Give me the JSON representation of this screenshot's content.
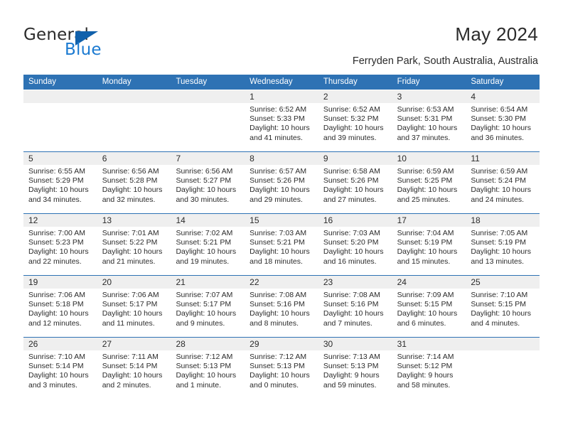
{
  "logo": {
    "word_one": "General",
    "word_two": "Blue",
    "triangle_color": "#1161ab",
    "blue_text_color": "#1b7ad1"
  },
  "header": {
    "title": "May 2024",
    "subtitle": "Ferryden Park, South Australia, Australia",
    "accent_color": "#2e72b4",
    "numrow_background": "#efefef"
  },
  "weekdays": [
    "Sunday",
    "Monday",
    "Tuesday",
    "Wednesday",
    "Thursday",
    "Friday",
    "Saturday"
  ],
  "weeks": [
    {
      "days": [
        {
          "number": "",
          "sunrise": "",
          "sunset": "",
          "daylight": ""
        },
        {
          "number": "",
          "sunrise": "",
          "sunset": "",
          "daylight": ""
        },
        {
          "number": "",
          "sunrise": "",
          "sunset": "",
          "daylight": ""
        },
        {
          "number": "1",
          "sunrise": "Sunrise: 6:52 AM",
          "sunset": "Sunset: 5:33 PM",
          "daylight": "Daylight: 10 hours and 41 minutes."
        },
        {
          "number": "2",
          "sunrise": "Sunrise: 6:52 AM",
          "sunset": "Sunset: 5:32 PM",
          "daylight": "Daylight: 10 hours and 39 minutes."
        },
        {
          "number": "3",
          "sunrise": "Sunrise: 6:53 AM",
          "sunset": "Sunset: 5:31 PM",
          "daylight": "Daylight: 10 hours and 37 minutes."
        },
        {
          "number": "4",
          "sunrise": "Sunrise: 6:54 AM",
          "sunset": "Sunset: 5:30 PM",
          "daylight": "Daylight: 10 hours and 36 minutes."
        }
      ]
    },
    {
      "days": [
        {
          "number": "5",
          "sunrise": "Sunrise: 6:55 AM",
          "sunset": "Sunset: 5:29 PM",
          "daylight": "Daylight: 10 hours and 34 minutes."
        },
        {
          "number": "6",
          "sunrise": "Sunrise: 6:56 AM",
          "sunset": "Sunset: 5:28 PM",
          "daylight": "Daylight: 10 hours and 32 minutes."
        },
        {
          "number": "7",
          "sunrise": "Sunrise: 6:56 AM",
          "sunset": "Sunset: 5:27 PM",
          "daylight": "Daylight: 10 hours and 30 minutes."
        },
        {
          "number": "8",
          "sunrise": "Sunrise: 6:57 AM",
          "sunset": "Sunset: 5:26 PM",
          "daylight": "Daylight: 10 hours and 29 minutes."
        },
        {
          "number": "9",
          "sunrise": "Sunrise: 6:58 AM",
          "sunset": "Sunset: 5:26 PM",
          "daylight": "Daylight: 10 hours and 27 minutes."
        },
        {
          "number": "10",
          "sunrise": "Sunrise: 6:59 AM",
          "sunset": "Sunset: 5:25 PM",
          "daylight": "Daylight: 10 hours and 25 minutes."
        },
        {
          "number": "11",
          "sunrise": "Sunrise: 6:59 AM",
          "sunset": "Sunset: 5:24 PM",
          "daylight": "Daylight: 10 hours and 24 minutes."
        }
      ]
    },
    {
      "days": [
        {
          "number": "12",
          "sunrise": "Sunrise: 7:00 AM",
          "sunset": "Sunset: 5:23 PM",
          "daylight": "Daylight: 10 hours and 22 minutes."
        },
        {
          "number": "13",
          "sunrise": "Sunrise: 7:01 AM",
          "sunset": "Sunset: 5:22 PM",
          "daylight": "Daylight: 10 hours and 21 minutes."
        },
        {
          "number": "14",
          "sunrise": "Sunrise: 7:02 AM",
          "sunset": "Sunset: 5:21 PM",
          "daylight": "Daylight: 10 hours and 19 minutes."
        },
        {
          "number": "15",
          "sunrise": "Sunrise: 7:03 AM",
          "sunset": "Sunset: 5:21 PM",
          "daylight": "Daylight: 10 hours and 18 minutes."
        },
        {
          "number": "16",
          "sunrise": "Sunrise: 7:03 AM",
          "sunset": "Sunset: 5:20 PM",
          "daylight": "Daylight: 10 hours and 16 minutes."
        },
        {
          "number": "17",
          "sunrise": "Sunrise: 7:04 AM",
          "sunset": "Sunset: 5:19 PM",
          "daylight": "Daylight: 10 hours and 15 minutes."
        },
        {
          "number": "18",
          "sunrise": "Sunrise: 7:05 AM",
          "sunset": "Sunset: 5:19 PM",
          "daylight": "Daylight: 10 hours and 13 minutes."
        }
      ]
    },
    {
      "days": [
        {
          "number": "19",
          "sunrise": "Sunrise: 7:06 AM",
          "sunset": "Sunset: 5:18 PM",
          "daylight": "Daylight: 10 hours and 12 minutes."
        },
        {
          "number": "20",
          "sunrise": "Sunrise: 7:06 AM",
          "sunset": "Sunset: 5:17 PM",
          "daylight": "Daylight: 10 hours and 11 minutes."
        },
        {
          "number": "21",
          "sunrise": "Sunrise: 7:07 AM",
          "sunset": "Sunset: 5:17 PM",
          "daylight": "Daylight: 10 hours and 9 minutes."
        },
        {
          "number": "22",
          "sunrise": "Sunrise: 7:08 AM",
          "sunset": "Sunset: 5:16 PM",
          "daylight": "Daylight: 10 hours and 8 minutes."
        },
        {
          "number": "23",
          "sunrise": "Sunrise: 7:08 AM",
          "sunset": "Sunset: 5:16 PM",
          "daylight": "Daylight: 10 hours and 7 minutes."
        },
        {
          "number": "24",
          "sunrise": "Sunrise: 7:09 AM",
          "sunset": "Sunset: 5:15 PM",
          "daylight": "Daylight: 10 hours and 6 minutes."
        },
        {
          "number": "25",
          "sunrise": "Sunrise: 7:10 AM",
          "sunset": "Sunset: 5:15 PM",
          "daylight": "Daylight: 10 hours and 4 minutes."
        }
      ]
    },
    {
      "days": [
        {
          "number": "26",
          "sunrise": "Sunrise: 7:10 AM",
          "sunset": "Sunset: 5:14 PM",
          "daylight": "Daylight: 10 hours and 3 minutes."
        },
        {
          "number": "27",
          "sunrise": "Sunrise: 7:11 AM",
          "sunset": "Sunset: 5:14 PM",
          "daylight": "Daylight: 10 hours and 2 minutes."
        },
        {
          "number": "28",
          "sunrise": "Sunrise: 7:12 AM",
          "sunset": "Sunset: 5:13 PM",
          "daylight": "Daylight: 10 hours and 1 minute."
        },
        {
          "number": "29",
          "sunrise": "Sunrise: 7:12 AM",
          "sunset": "Sunset: 5:13 PM",
          "daylight": "Daylight: 10 hours and 0 minutes."
        },
        {
          "number": "30",
          "sunrise": "Sunrise: 7:13 AM",
          "sunset": "Sunset: 5:13 PM",
          "daylight": "Daylight: 9 hours and 59 minutes."
        },
        {
          "number": "31",
          "sunrise": "Sunrise: 7:14 AM",
          "sunset": "Sunset: 5:12 PM",
          "daylight": "Daylight: 9 hours and 58 minutes."
        },
        {
          "number": "",
          "sunrise": "",
          "sunset": "",
          "daylight": ""
        }
      ]
    }
  ]
}
